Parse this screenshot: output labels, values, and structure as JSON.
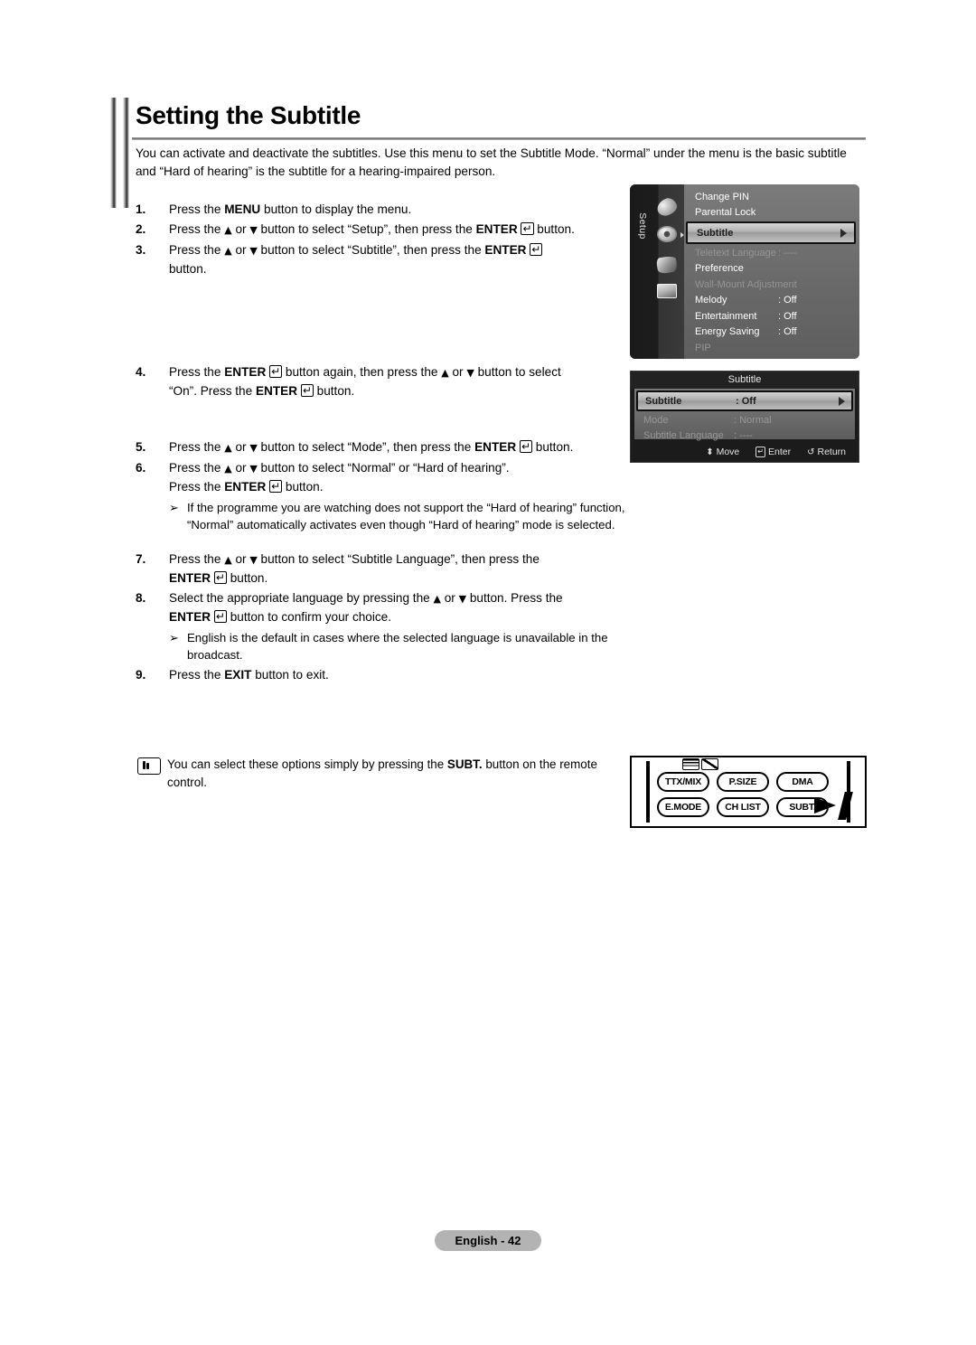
{
  "page": {
    "title": "Setting the Subtitle",
    "intro": "You can activate and deactivate the subtitles. Use this menu to set the Subtitle Mode. “Normal” under the menu is the basic subtitle and “Hard of hearing” is the subtitle for a hearing-impaired person.",
    "footer_label": "English - 42"
  },
  "steps": [
    {
      "num": "1.",
      "text": "Press the MENU button to display the menu.",
      "bold": [
        "MENU"
      ]
    },
    {
      "num": "2.",
      "text": "Press the ▲ or ▼ button to select “Setup”, then press the ENTER ⏎ button."
    },
    {
      "num": "3.",
      "text": "Press the ▲ or ▼ button to select “Subtitle”, then press the ENTER ⏎ button."
    },
    {
      "num": "4.",
      "text": "Press the ENTER ⏎ button again, then press the ▲ or ▼ button to select “On”. Press the ENTER ⏎ button."
    },
    {
      "num": "5.",
      "text": "Press the ▲ or ▼ button to select “Mode”, then press the ENTER ⏎ button."
    },
    {
      "num": "6.",
      "text": "Press the ▲ or ▼ button to select “Normal” or “Hard of hearing”. Press the ENTER ⏎ button."
    },
    {
      "num": "7.",
      "text": "Press the ▲ or ▼ button to select “Subtitle Language”, then press the ENTER ⏎ button."
    },
    {
      "num": "8.",
      "text": "Select the appropriate language by pressing the ▲ or ▼ button. Press the ENTER ⏎ button to confirm your choice."
    },
    {
      "num": "9.",
      "text": "Press the EXIT button to exit.",
      "bold": [
        "EXIT"
      ]
    }
  ],
  "subnotes": {
    "after_step_6": "If the programme you are watching does not support the “Hard of hearing” function, “Normal” automatically activates even though “Hard of hearing” mode is selected.",
    "after_step_8": "English is the default in cases where the selected language is unavailable in the broadcast."
  },
  "note": {
    "mark": "note-icon",
    "text_parts": {
      "a": "You can select these options simply by pressing the ",
      "b": "SUBT.",
      "c": " button on the remote control."
    }
  },
  "tv_menu": {
    "tab_label": "Setup",
    "icons": [
      "hand-icon",
      "gear-icon",
      "plug-icon",
      "screen-icon"
    ],
    "rows": [
      {
        "label": "Change PIN",
        "value": "",
        "state": "normal"
      },
      {
        "label": "Parental Lock",
        "value": "",
        "state": "normal"
      },
      {
        "label": "Subtitle",
        "value": "",
        "state": "selected"
      },
      {
        "label": "Teletext Language",
        "value": ": ----",
        "state": "disabled"
      },
      {
        "label": "Preference",
        "value": "",
        "state": "normal"
      },
      {
        "label": "Wall-Mount Adjustment",
        "value": "",
        "state": "disabled"
      },
      {
        "label": "Melody",
        "value": ": Off",
        "state": "normal"
      },
      {
        "label": "Entertainment",
        "value": ": Off",
        "state": "normal"
      },
      {
        "label": "Energy Saving",
        "value": ": Off",
        "state": "normal"
      },
      {
        "label": "PIP",
        "value": "",
        "state": "disabled"
      }
    ]
  },
  "tv_submenu": {
    "title": "Subtitle",
    "rows": [
      {
        "label": "Subtitle",
        "value": ": Off",
        "state": "selected"
      },
      {
        "label": "Mode",
        "value": ": Normal",
        "state": "disabled"
      },
      {
        "label": "Subtitle Language",
        "value": ": ----",
        "state": "disabled"
      }
    ],
    "nav": [
      {
        "glyph": "⬍",
        "label": "Move",
        "icon": "move-updown-icon"
      },
      {
        "glyph": "⏎",
        "label": "Enter",
        "icon": "enter-icon"
      },
      {
        "glyph": "↺",
        "label": "Return",
        "icon": "return-icon"
      }
    ]
  },
  "remote": {
    "icon_name": "teletext-mix-icon",
    "buttons": [
      "TTX/MIX",
      "P.SIZE",
      "DMA",
      "E.MODE",
      "CH LIST",
      "SUBT."
    ],
    "pointer_target": "SUBT."
  }
}
